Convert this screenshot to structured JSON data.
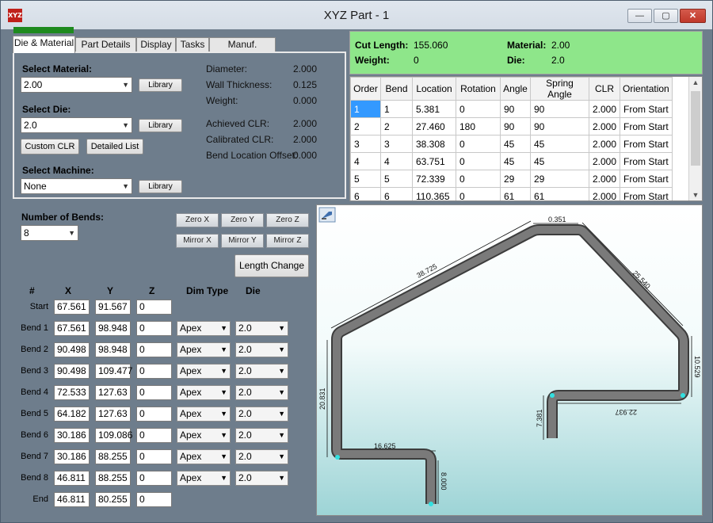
{
  "window": {
    "title": "XYZ Part - 1",
    "app_icon_text": "XYZ",
    "min": "—",
    "max": "▢",
    "close": "✕"
  },
  "tabs": [
    "Die & Material",
    "Part Details",
    "Display",
    "Tasks",
    "Manuf. Warning"
  ],
  "material_panel": {
    "select_material_label": "Select Material:",
    "material_value": "2.00",
    "select_die_label": "Select Die:",
    "die_value": "2.0",
    "select_machine_label": "Select Machine:",
    "machine_value": "None",
    "library_label": "Library",
    "custom_clr_label": "Custom CLR",
    "detailed_list_label": "Detailed List",
    "props": [
      {
        "label": "Diameter:",
        "value": "2.000"
      },
      {
        "label": "Wall Thickness:",
        "value": "0.125"
      },
      {
        "label": "Weight:",
        "value": "0.000"
      },
      {
        "label": "Achieved CLR:",
        "value": "2.000"
      },
      {
        "label": "Calibrated CLR:",
        "value": "2.000"
      },
      {
        "label": "Bend Location Offset:",
        "value": "0.000"
      }
    ]
  },
  "info": {
    "cut_length_label": "Cut Length:",
    "cut_length": "155.060",
    "weight_label": "Weight:",
    "weight": "0",
    "material_label": "Material:",
    "material": "2.00",
    "die_label": "Die:",
    "die": "2.0",
    "accent": "#8ee68a"
  },
  "bend_table": {
    "columns": [
      "Order",
      "Bend",
      "Location",
      "Rotation",
      "Angle",
      "Spring Angle",
      "CLR",
      "Orientation"
    ],
    "rows": [
      [
        "1",
        "1",
        "5.381",
        "0",
        "90",
        "90",
        "2.000",
        "From Start"
      ],
      [
        "2",
        "2",
        "27.460",
        "180",
        "90",
        "90",
        "2.000",
        "From Start"
      ],
      [
        "3",
        "3",
        "38.308",
        "0",
        "45",
        "45",
        "2.000",
        "From Start"
      ],
      [
        "4",
        "4",
        "63.751",
        "0",
        "45",
        "45",
        "2.000",
        "From Start"
      ],
      [
        "5",
        "5",
        "72.339",
        "0",
        "29",
        "29",
        "2.000",
        "From Start"
      ],
      [
        "6",
        "6",
        "110.365",
        "0",
        "61",
        "61",
        "2.000",
        "From Start"
      ]
    ]
  },
  "coords": {
    "number_of_bends_label": "Number of Bends:",
    "number_of_bends": "8",
    "buttons": [
      "Zero X",
      "Zero Y",
      "Zero Z",
      "Mirror X",
      "Mirror Y",
      "Mirror Z"
    ],
    "length_change_label": "Length Change",
    "headers": [
      "#",
      "X",
      "Y",
      "Z",
      "Dim Type",
      "Die"
    ],
    "rows": [
      {
        "label": "Start",
        "x": "67.561",
        "y": "91.567",
        "z": "0",
        "dim": "",
        "die": ""
      },
      {
        "label": "Bend 1",
        "x": "67.561",
        "y": "98.948",
        "z": "0",
        "dim": "Apex",
        "die": "2.0"
      },
      {
        "label": "Bend 2",
        "x": "90.498",
        "y": "98.948",
        "z": "0",
        "dim": "Apex",
        "die": "2.0"
      },
      {
        "label": "Bend 3",
        "x": "90.498",
        "y": "109.477",
        "z": "0",
        "dim": "Apex",
        "die": "2.0"
      },
      {
        "label": "Bend 4",
        "x": "72.533",
        "y": "127.63",
        "z": "0",
        "dim": "Apex",
        "die": "2.0"
      },
      {
        "label": "Bend 5",
        "x": "64.182",
        "y": "127.63",
        "z": "0",
        "dim": "Apex",
        "die": "2.0"
      },
      {
        "label": "Bend 6",
        "x": "30.186",
        "y": "109.086",
        "z": "0",
        "dim": "Apex",
        "die": "2.0"
      },
      {
        "label": "Bend 7",
        "x": "30.186",
        "y": "88.255",
        "z": "0",
        "dim": "Apex",
        "die": "2.0"
      },
      {
        "label": "Bend 8",
        "x": "46.811",
        "y": "88.255",
        "z": "0",
        "dim": "Apex",
        "die": "2.0"
      },
      {
        "label": "End",
        "x": "46.811",
        "y": "80.255",
        "z": "0",
        "dim": "",
        "die": ""
      }
    ]
  },
  "drawing": {
    "dimensions": [
      "0.351",
      "38.725",
      "25.540",
      "10.529",
      "22.937",
      "7.381",
      "20.831",
      "16.625",
      "8.000"
    ],
    "tube_color": "#7a7a7a",
    "endpoint_color": "#32e0e0"
  }
}
